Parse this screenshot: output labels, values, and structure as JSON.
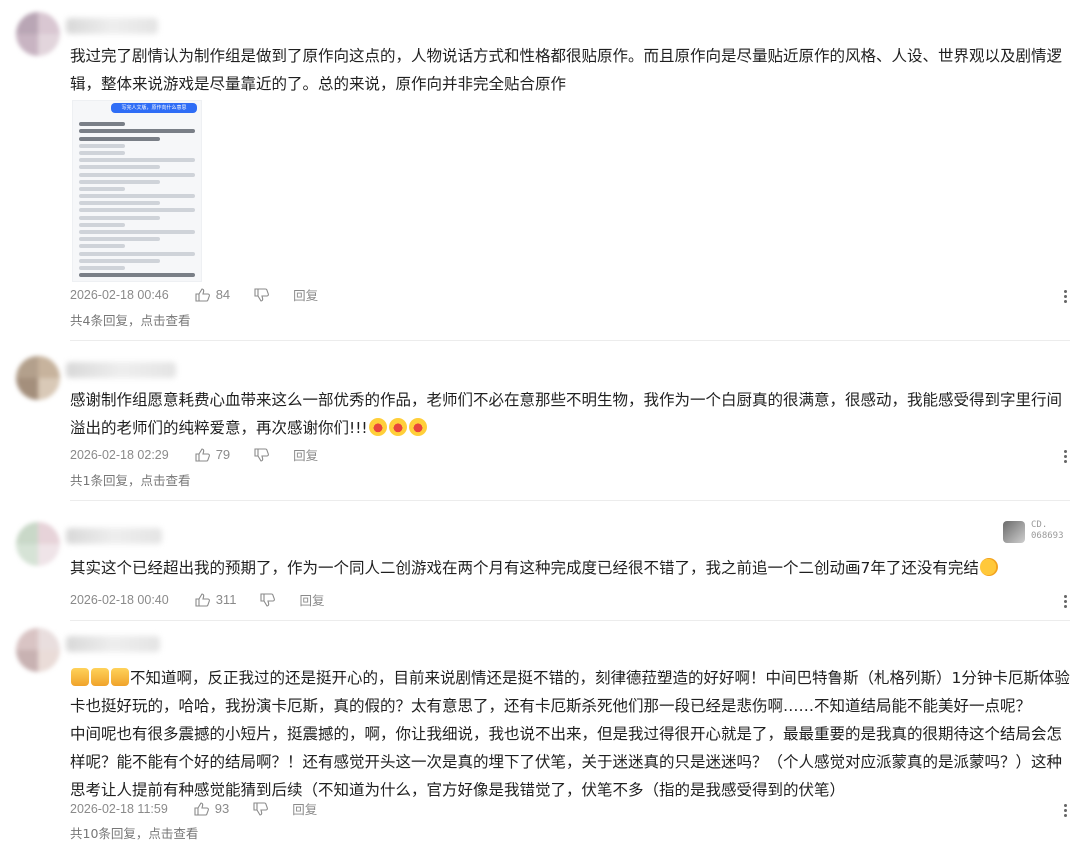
{
  "comments": [
    {
      "text": "我过完了剧情认为制作组是做到了原作向这点的，人物说话方式和性格都很贴原作。而且原作向是尽量贴近原作的风格、人设、世界观以及剧情逻辑，整体来说游戏是尽量靠近的了。总的来说，原作向并非完全贴合原作",
      "time": "2026-02-18 00:46",
      "likes": "84",
      "reply_label": "回复",
      "replies_label": "共4条回复，点击查看"
    },
    {
      "text": "感谢制作组愿意耗费心血带来这么一部优秀的作品，老师们不必在意那些不明生物，我作为一个白厨真的很满意，很感动，我能感受得到字里行间溢出的老师们的纯粹爱意，再次感谢你们!!!",
      "time": "2026-02-18 02:29",
      "likes": "79",
      "reply_label": "回复",
      "replies_label": "共1条回复，点击查看"
    },
    {
      "text": "其实这个已经超出我的预期了，作为一个同人二创游戏在两个月有这种完成度已经很不错了，我之前追一个二创动画7年了还没有完结",
      "time": "2026-02-18 00:40",
      "likes": "311",
      "reply_label": "回复",
      "badge_text_1": "CD.",
      "badge_text_2": "068693"
    },
    {
      "text": "不知道啊，反正我过的还是挺开心的，目前来说剧情还是挺不错的，刻律德菈塑造的好好啊！中间巴特鲁斯（札格列斯）1分钟卡厄斯体验卡也挺好玩的，哈哈，我扮演卡厄斯，真的假的？太有意思了，还有卡厄斯杀死他们那一段已经是悲伤啊……不知道结局能不能美好一点呢？",
      "text2": "中间呢也有很多震撼的小短片，挺震撼的，啊，你让我细说，我也说不出来，但是我过得很开心就是了，最最重要的是我真的很期待这个结局会怎样呢？能不能有个好的结局啊？！还有感觉开头这一次是真的埋下了伏笔，关于迷迷真的只是迷迷吗？（个人感觉对应派蒙真的是派蒙吗？）这种思考让人提前有种感觉能猜到后续（不知道为什么，官方好像是我错觉了，伏笔不多（指的是我感受得到的伏笔）",
      "time": "2026-02-18 11:59",
      "likes": "93",
      "reply_label": "回复",
      "replies_label": "共10条回复，点击查看"
    }
  ],
  "thumbnail": {
    "header": "写完人文版，原作向什么意思"
  },
  "colors": {
    "meta": "#8a8a8a",
    "text": "#1f1f1f",
    "accent": "#2f6df6"
  }
}
